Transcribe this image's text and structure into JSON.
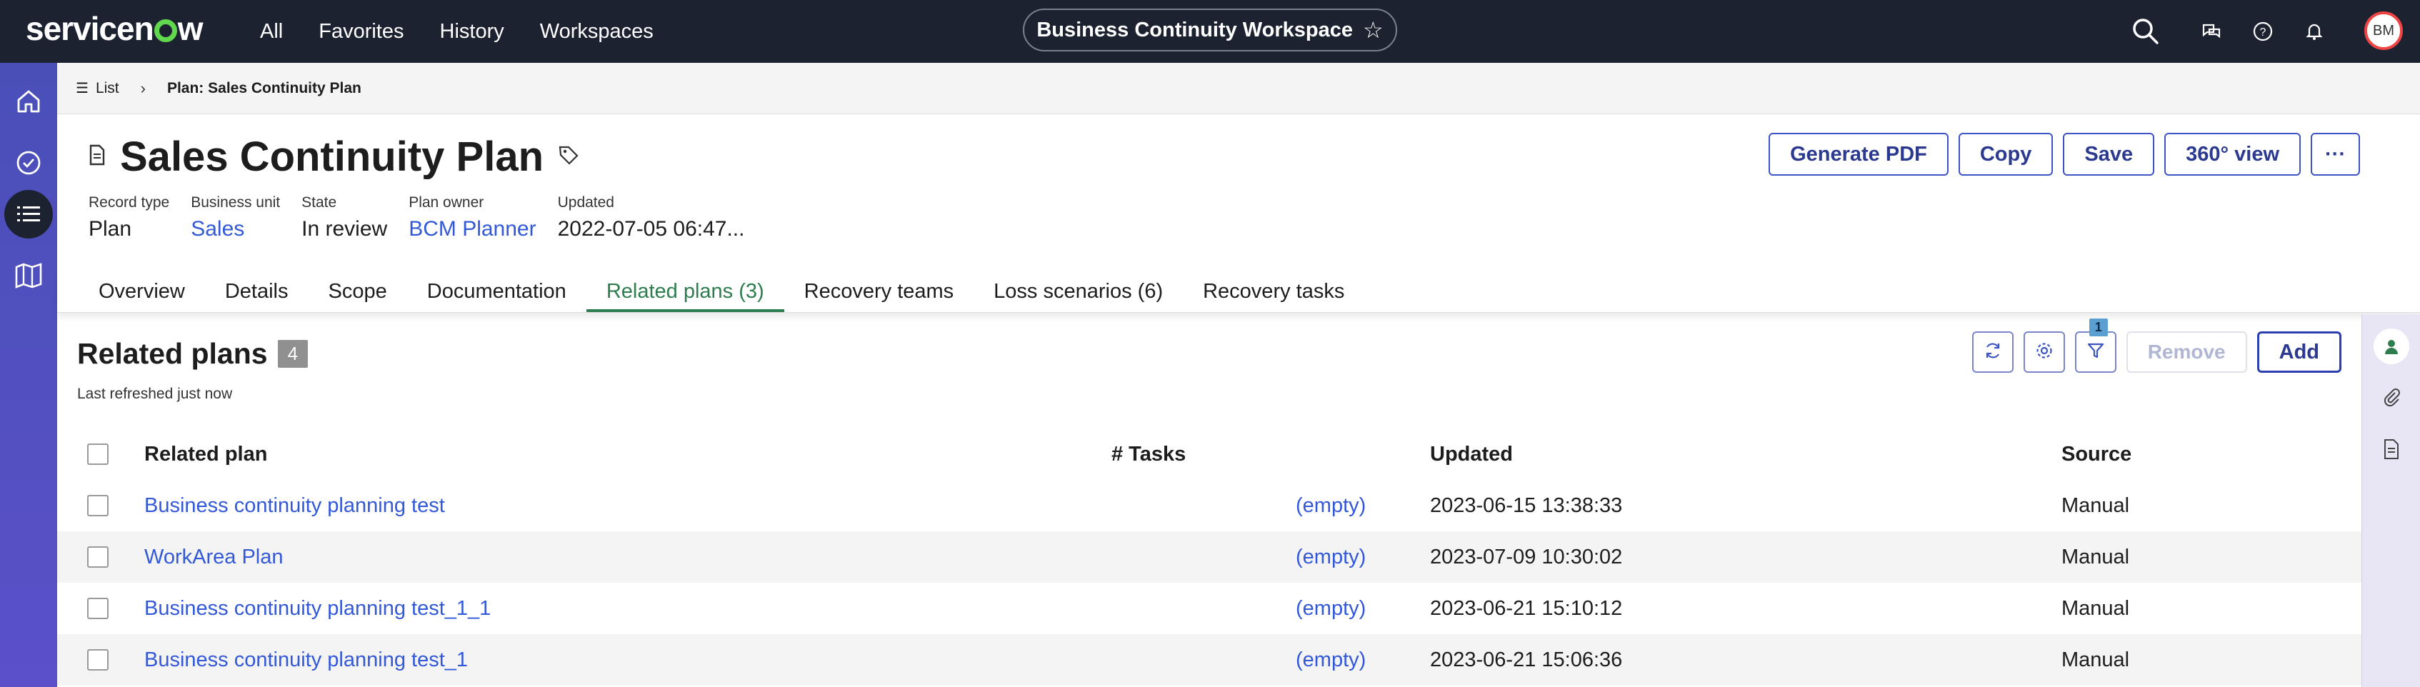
{
  "app": {
    "logo_text": "servicenow",
    "nav": [
      "All",
      "Favorites",
      "History",
      "Workspaces"
    ],
    "workspace_title": "Business Continuity Workspace",
    "user_initials": "BM"
  },
  "breadcrumb": {
    "list_label": "List",
    "current": "Plan: Sales Continuity Plan"
  },
  "record": {
    "title": "Sales Continuity Plan",
    "fields": [
      {
        "label": "Record type",
        "value": "Plan",
        "link": false
      },
      {
        "label": "Business unit",
        "value": "Sales",
        "link": true
      },
      {
        "label": "State",
        "value": "In review",
        "link": false
      },
      {
        "label": "Plan owner",
        "value": "BCM Planner",
        "link": true
      },
      {
        "label": "Updated",
        "value": "2022-07-05 06:47...",
        "link": false
      }
    ],
    "actions": {
      "generate_pdf": "Generate PDF",
      "copy": "Copy",
      "save": "Save",
      "view360": "360° view",
      "more": "···"
    }
  },
  "tabs": [
    {
      "label": "Overview",
      "active": false
    },
    {
      "label": "Details",
      "active": false
    },
    {
      "label": "Scope",
      "active": false
    },
    {
      "label": "Documentation",
      "active": false
    },
    {
      "label": "Related plans (3)",
      "active": true
    },
    {
      "label": "Recovery teams",
      "active": false
    },
    {
      "label": "Loss scenarios (6)",
      "active": false
    },
    {
      "label": "Recovery tasks",
      "active": false
    }
  ],
  "related": {
    "title": "Related plans",
    "count": "4",
    "refreshed": "Last refreshed just now",
    "filter_count": "1",
    "remove_label": "Remove",
    "add_label": "Add",
    "columns": {
      "plan": "Related plan",
      "tasks": "# Tasks",
      "updated": "Updated",
      "source": "Source"
    },
    "rows": [
      {
        "plan": "Business continuity planning test",
        "tasks": "(empty)",
        "updated": "2023-06-15 13:38:33",
        "source": "Manual"
      },
      {
        "plan": "WorkArea Plan",
        "tasks": "(empty)",
        "updated": "2023-07-09 10:30:02",
        "source": "Manual"
      },
      {
        "plan": "Business continuity planning test_1_1",
        "tasks": "(empty)",
        "updated": "2023-06-21 15:10:12",
        "source": "Manual"
      },
      {
        "plan": "Business continuity planning test_1",
        "tasks": "(empty)",
        "updated": "2023-06-21 15:06:36",
        "source": "Manual"
      }
    ]
  },
  "colors": {
    "topbar": "#1d2231",
    "rail": "#4a4fb8",
    "link": "#3359d9",
    "active_tab": "#2e7d4f",
    "button_border": "#3d55c4"
  }
}
